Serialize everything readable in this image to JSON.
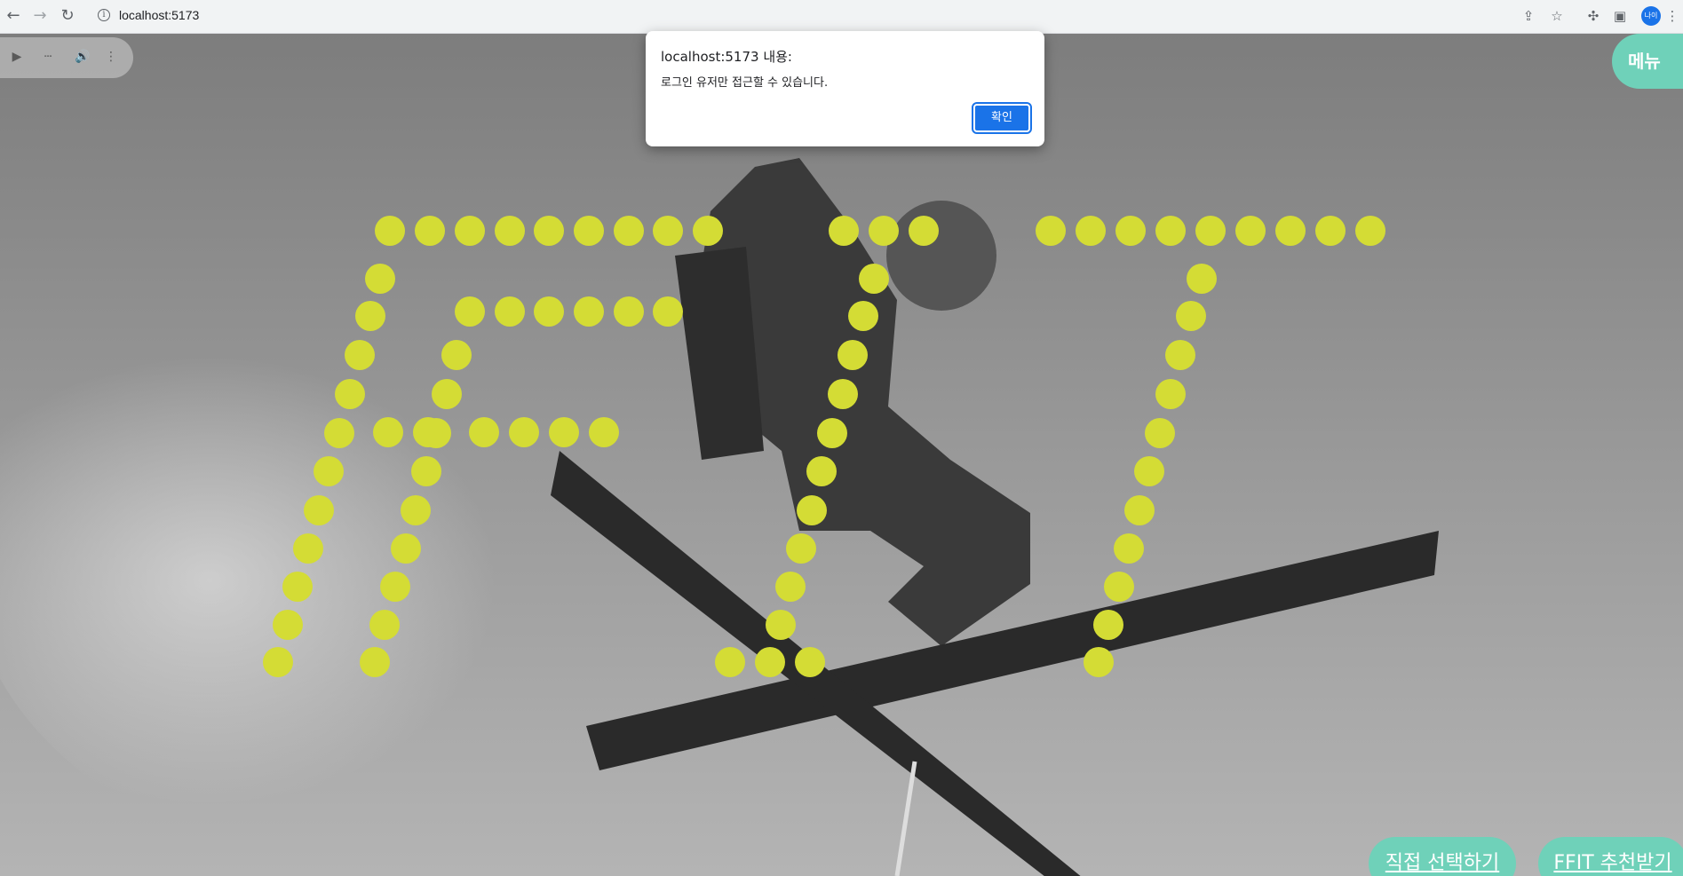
{
  "browser": {
    "url": "localhost:5173",
    "profile_label": "나이"
  },
  "page": {
    "menu_label": "메뉴",
    "choose_label": "직접 선택하기",
    "recommend_label": "FFIT 추천받기",
    "accent_color": "#d4dc35",
    "button_color": "#6fd1b9"
  },
  "alert": {
    "title": "localhost:5173 내용:",
    "message": "로그인 유저만 접근할 수 있습니다.",
    "ok_label": "확인"
  }
}
